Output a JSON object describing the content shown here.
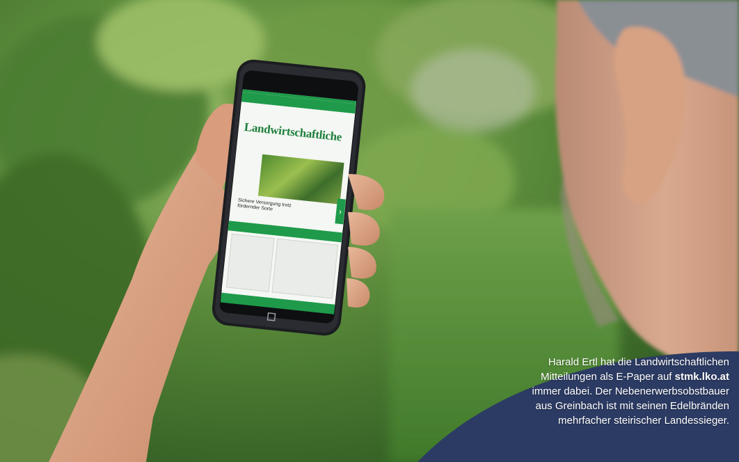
{
  "caption": {
    "line1": "Harald Ertl hat die Landwirtschaftlichen",
    "line2_before": "Mitteilungen als E-Paper auf ",
    "line2_link": "stmk.lko.at",
    "line3": "immer dabei. Der Nebenerwerbsobstbauer",
    "line4": "aus Greinbach ist mit seinen Edelbränden",
    "line5": "mehrfacher steirischer Landessieger."
  },
  "phone_screen": {
    "masthead": "Landwirtschaftliche",
    "teaser": "Sichere Versorgung trotz fördernder Sorte"
  },
  "colors": {
    "app_green": "#1e9a4a",
    "foliage": "#3f6b2a",
    "caption_text": "#ffffff",
    "shirt_blue": "#2c3b63"
  }
}
